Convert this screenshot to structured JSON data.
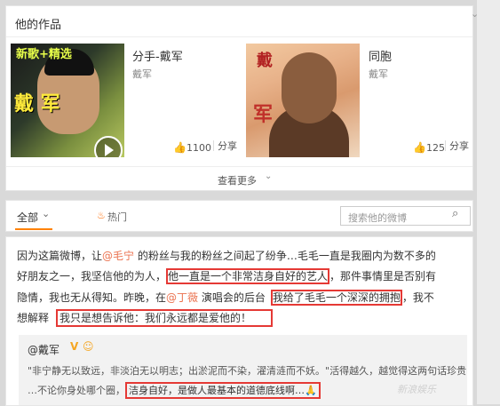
{
  "works": {
    "title": "他的作品",
    "items": [
      {
        "song": "分手-戴军",
        "artist": "戴军",
        "likes": "1100",
        "share": "分享",
        "cover_text_small": "新歌+精选",
        "cover_text_big": "戴 军"
      },
      {
        "song": "同胞",
        "artist": "戴军",
        "likes": "125",
        "share": "分享",
        "cover_text_small": "戴",
        "cover_text_big": "军"
      }
    ],
    "more": "查看更多"
  },
  "tabs": {
    "all": "全部",
    "hot": "热门",
    "search_placeholder": "搜索他的微博"
  },
  "post": {
    "lines": [
      [
        "因为这篇微博，让",
        "@毛宁",
        " 的粉丝与我的粉丝之间起了纷争…毛毛一直是我圈内为数不多的"
      ],
      [
        "好朋友之一，我坚信他的为人，",
        "他一直是一个非常洁身自好的艺人",
        "，那件事情里是否别有"
      ],
      [
        "隐情，我也无从得知。昨晚，在",
        "@丁薇",
        " 演唱会的后台",
        "我给了毛毛一个深深的拥抱",
        "，我不"
      ],
      [
        "想解释",
        "我只是想告诉他：我们永远都是爱他的！"
      ]
    ],
    "quote": {
      "name": "@戴军",
      "line1": "\"非宁静无以致远，非淡泊无以明志；出淤泥而不染，濯清涟而不妖。\"活得越久，越觉得这两句话珍贵",
      "line2a": "…不论你身处哪个圈，",
      "line2b": "洁身自好，是做人最基本的道德底线啊…",
      "emoji": "🙏"
    }
  },
  "watermark": "新浪娱乐"
}
